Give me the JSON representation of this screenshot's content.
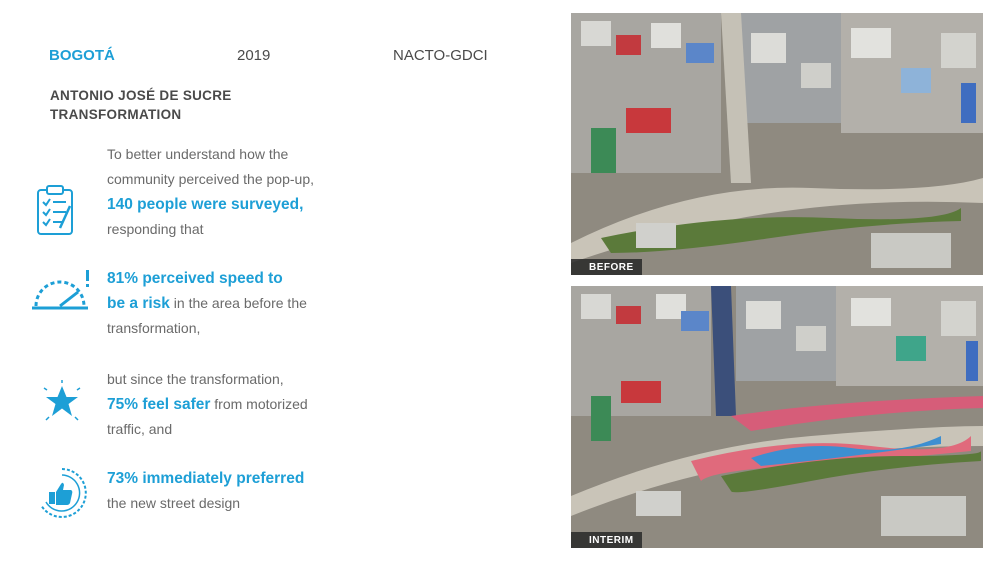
{
  "header": {
    "city": "BOGOTÁ",
    "year": "2019",
    "org": "NACTO-GDCI"
  },
  "title": "ANTONIO JOSÉ DE SUCRE TRANSFORMATION",
  "stats": [
    {
      "icon": "clipboard-checklist-icon",
      "pre": "To better understand how the community perceived the pop-up,",
      "highlight": "140 people were surveyed,",
      "post": "responding that"
    },
    {
      "icon": "speedometer-warning-icon",
      "highlight_a": "81% perceived speed to",
      "highlight_b": "be a risk",
      "post": " in the area before the transformation,"
    },
    {
      "icon": "star-icon",
      "pre": "but since the transformation,",
      "highlight": "75% feel safer",
      "post": " from motorized traffic, and"
    },
    {
      "icon": "thumbs-up-icon",
      "highlight": "73% immediately preferred",
      "post": "the new street design"
    }
  ],
  "photos": [
    {
      "label": "BEFORE"
    },
    {
      "label": "INTERIM"
    }
  ],
  "colors": {
    "accent": "#1d9fd6",
    "text": "#6a6a6a"
  }
}
